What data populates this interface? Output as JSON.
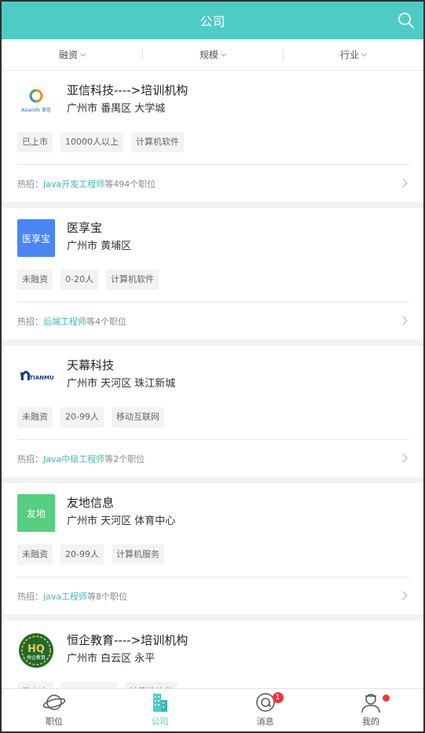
{
  "header": {
    "title": "公司"
  },
  "filters": [
    {
      "label": "融资"
    },
    {
      "label": "规模"
    },
    {
      "label": "行业"
    }
  ],
  "companies": [
    {
      "name": "亚信科技---->培训机构",
      "address": "广州市 番禺区 大学城",
      "tags": [
        "已上市",
        "10000人以上",
        "计算机软件"
      ],
      "hot_prefix": "热招：",
      "hot_job": "Java开发工程师",
      "hot_suffix": "等494个职位",
      "logo": {
        "type": "asiainfo",
        "text": "Asiainfo 亚信"
      }
    },
    {
      "name": "医享宝",
      "address": "广州市 黄埔区",
      "tags": [
        "未融资",
        "0-20人",
        "计算机软件"
      ],
      "hot_prefix": "热招：",
      "hot_job": "后端工程师",
      "hot_suffix": "等4个职位",
      "logo": {
        "type": "text",
        "text": "医享宝",
        "bg": "#4a86f5"
      }
    },
    {
      "name": "天幕科技",
      "address": "广州市 天河区 珠江新城",
      "tags": [
        "未融资",
        "20-99人",
        "移动互联网"
      ],
      "hot_prefix": "热招：",
      "hot_job": "Java中级工程师",
      "hot_suffix": "等2个职位",
      "logo": {
        "type": "tianmu",
        "text": "TIANMU"
      }
    },
    {
      "name": "友地信息",
      "address": "广州市 天河区 体育中心",
      "tags": [
        "未融资",
        "20-99人",
        "计算机服务"
      ],
      "hot_prefix": "热招：",
      "hot_job": "java工程师",
      "hot_suffix": "等8个职位",
      "logo": {
        "type": "text",
        "text": "友地",
        "bg": "#56cf80"
      }
    },
    {
      "name": "恒企教育---->培训机构",
      "address": "广州市 白云区 永平",
      "tags": [
        "已上市",
        "",
        "计算机软件"
      ],
      "hot_prefix": "",
      "hot_job": "",
      "hot_suffix": "",
      "logo": {
        "type": "hengqi",
        "text": "恒企教育"
      }
    }
  ],
  "tabbar": {
    "items": [
      {
        "label": "职位",
        "icon": "planet-icon"
      },
      {
        "label": "公司",
        "icon": "building-icon",
        "active": true
      },
      {
        "label": "消息",
        "icon": "message-icon",
        "badge": "1"
      },
      {
        "label": "我的",
        "icon": "profile-icon"
      }
    ]
  },
  "colors": {
    "accent": "#4fcbc5",
    "badge": "#f0383e"
  }
}
